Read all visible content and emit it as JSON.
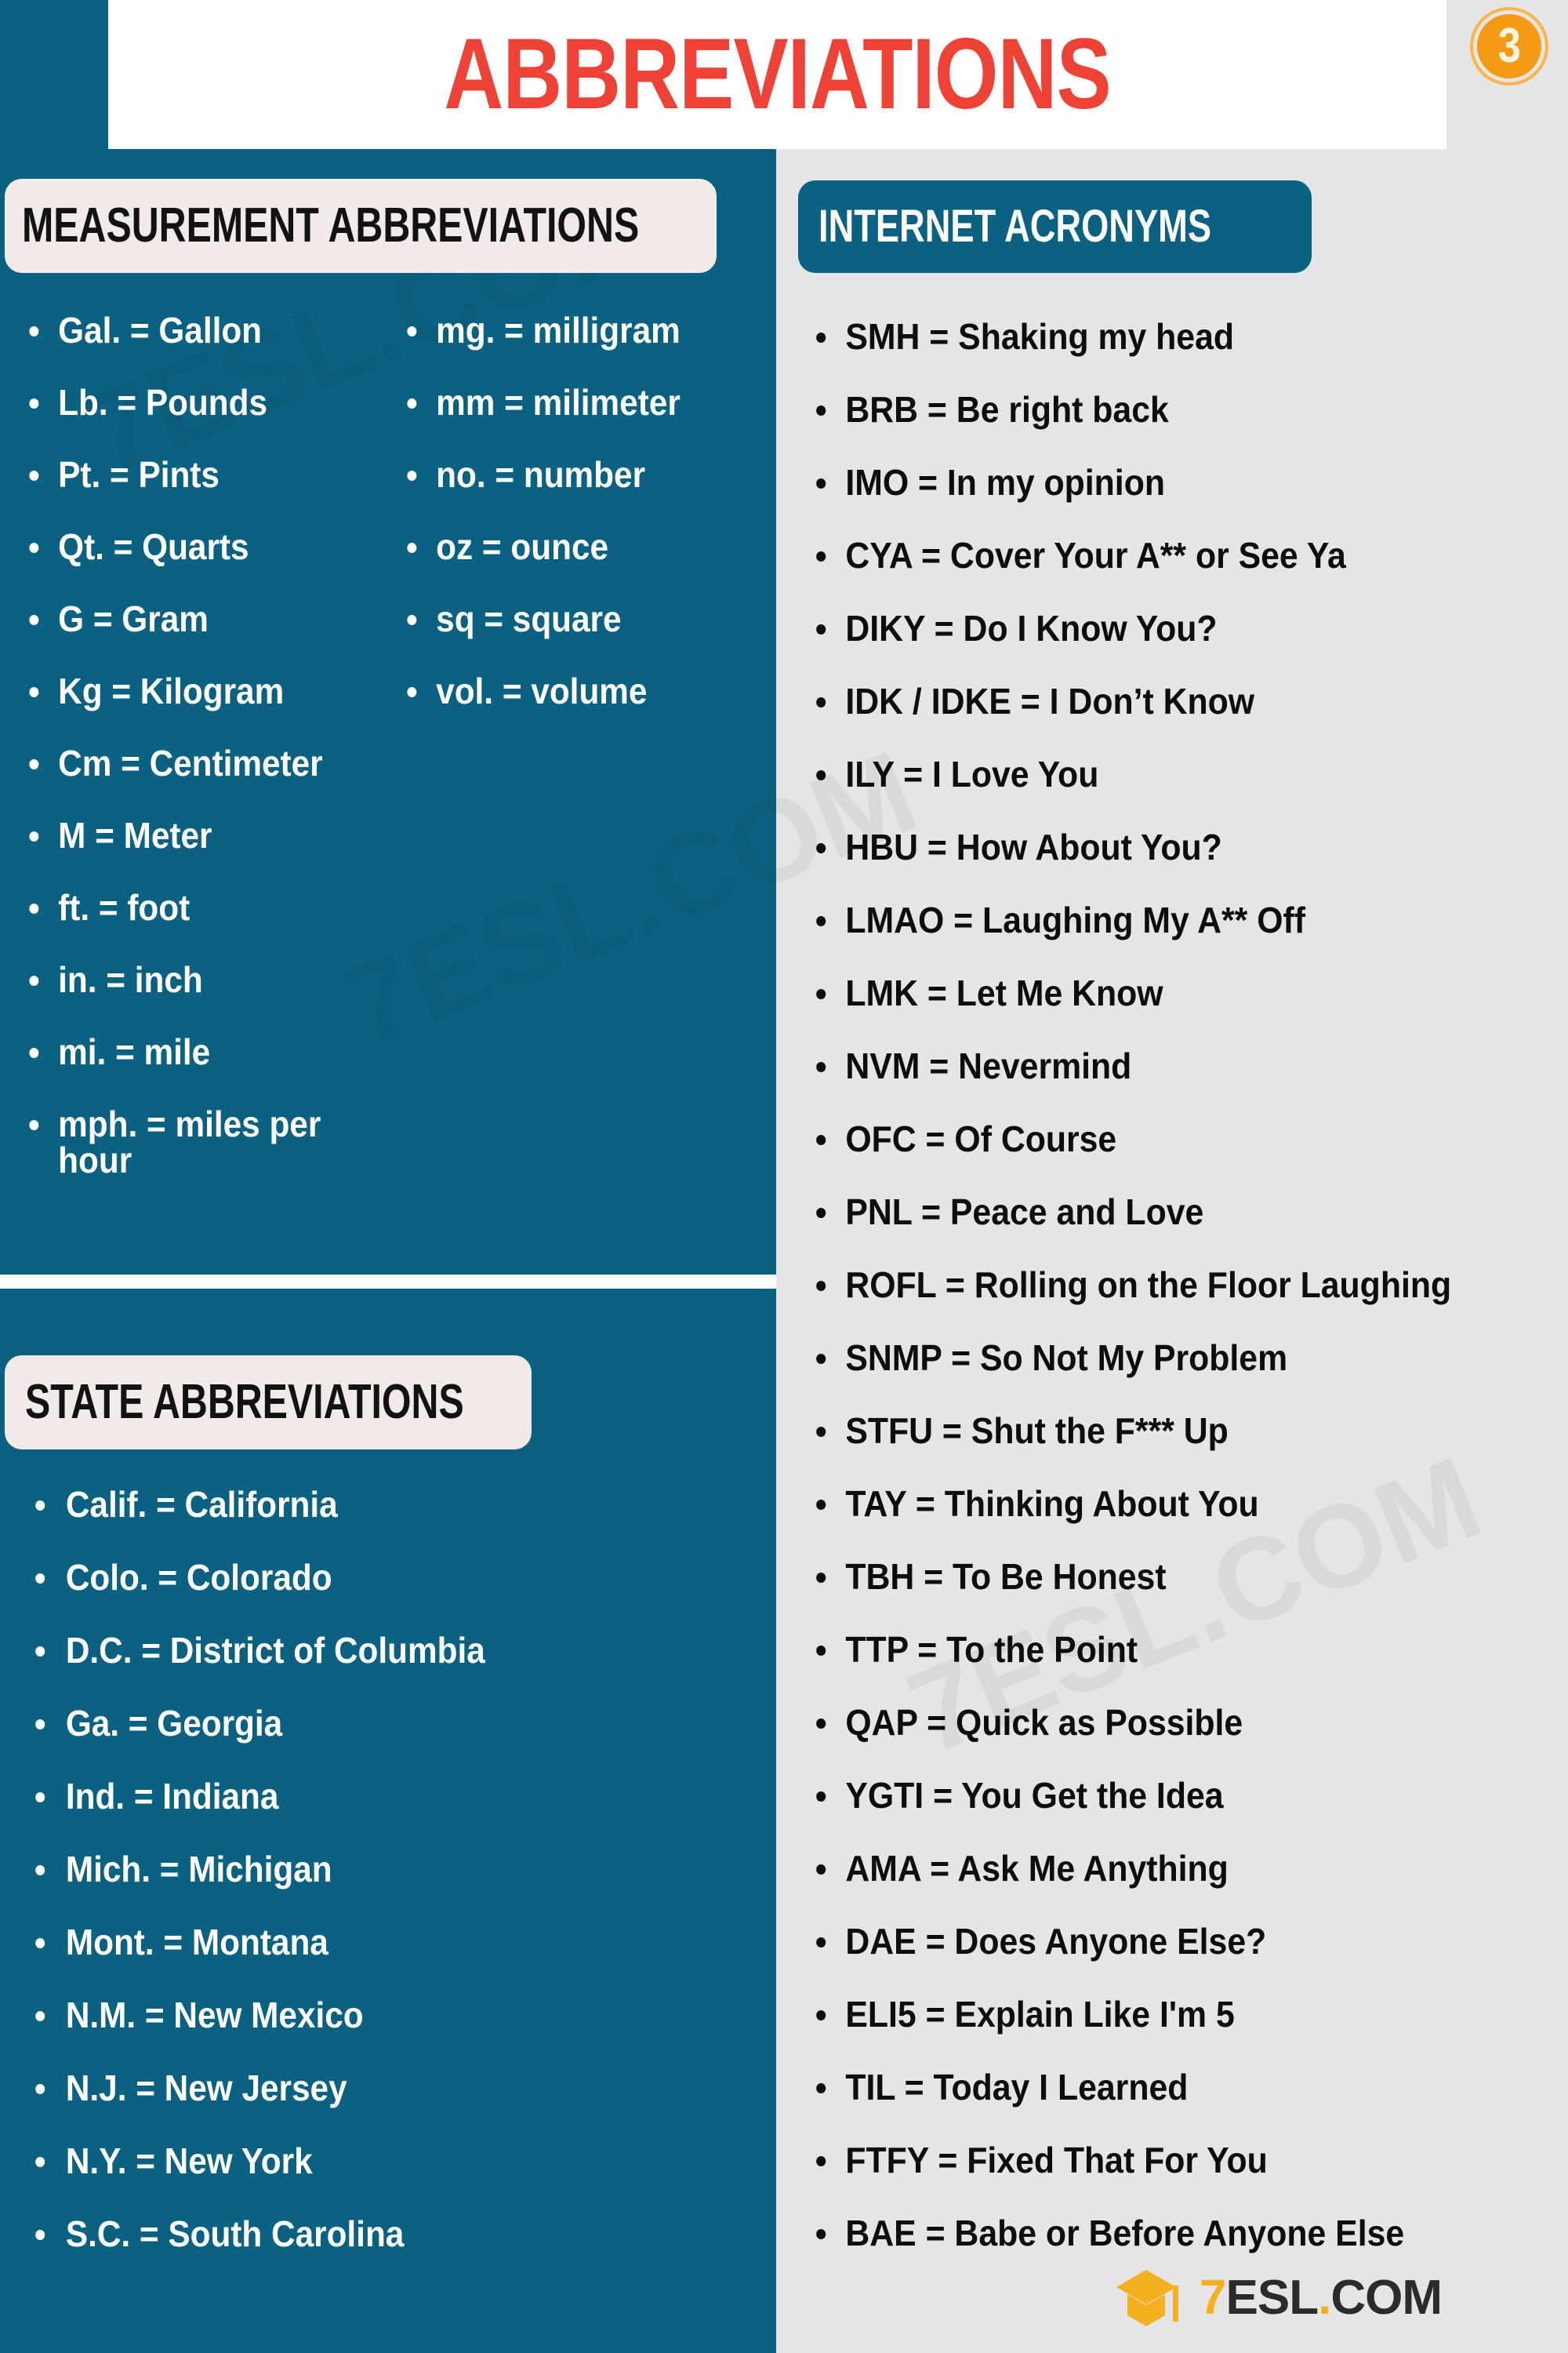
{
  "page": {
    "title": "ABBREVIATIONS",
    "badge_number": "3",
    "colors": {
      "teal_panel": "#0b6181",
      "title_red": "#ef4236",
      "badge_orange": "#f59a14",
      "pill_cream": "#f2eae8",
      "right_panel_gray": "#e5e5e5",
      "logo_yellow": "#f5b01e"
    }
  },
  "measurement_section": {
    "heading": "MEASUREMENT ABBREVIATIONS",
    "column_left": [
      "Gal. = Gallon",
      "Lb. = Pounds",
      "Pt. = Pints",
      "Qt. = Quarts",
      "G = Gram",
      "Kg = Kilogram",
      "Cm = Centimeter",
      "M = Meter",
      "ft. = foot",
      "in. = inch",
      "mi. = mile",
      "mph. = miles per hour"
    ],
    "column_right": [
      "mg. = milligram",
      "mm = milimeter",
      "no. = number",
      "oz = ounce",
      "sq = square",
      "vol. = volume"
    ]
  },
  "state_section": {
    "heading": "STATE ABBREVIATIONS",
    "items": [
      "Calif. = California",
      "Colo. = Colorado",
      "D.C. = District of Columbia",
      "Ga. = Georgia",
      "Ind. = Indiana",
      "Mich. = Michigan",
      "Mont. = Montana",
      "N.M. = New Mexico",
      "N.J. = New Jersey",
      "N.Y. = New York",
      "S.C. = South Carolina"
    ]
  },
  "internet_section": {
    "heading": "INTERNET ACRONYMS",
    "items": [
      "SMH = Shaking my head",
      "BRB = Be right back",
      "IMO = In my opinion",
      "CYA = Cover Your A** or See Ya",
      "DIKY = Do I Know You?",
      "IDK / IDKE = I Don’t Know",
      "ILY = I Love You",
      "HBU = How About You?",
      "LMAO = Laughing My A** Off",
      "LMK = Let Me Know",
      "NVM = Nevermind",
      "OFC = Of Course",
      "PNL = Peace and Love",
      "ROFL = Rolling on the Floor Laughing",
      "SNMP = So Not My Problem",
      "STFU = Shut the F*** Up",
      "TAY = Thinking About You",
      "TBH = To Be Honest",
      "TTP = To the Point",
      "QAP = Quick as Possible",
      "YGTI = You Get the Idea",
      "AMA = Ask Me Anything",
      "DAE = Does Anyone Else?",
      "ELI5 = Explain Like I'm 5",
      "TIL = Today I Learned",
      "FTFY = Fixed That For You",
      "BAE = Babe or Before Anyone Else"
    ]
  },
  "logo": {
    "seven": "7",
    "esl": "ESL",
    "dot": ".",
    "com": "COM"
  },
  "watermark": {
    "text": "7ESL.COM"
  }
}
